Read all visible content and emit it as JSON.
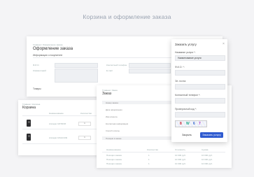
{
  "page_header": "Корзина и оформление заказа",
  "checkout": {
    "breadcrumb": "Главная / Оформление заказа",
    "title": "Оформление заказа",
    "section_buyer": "Информация о покупателе",
    "field_name": "Ф.И.О.",
    "field_comment": "Комментарий",
    "field_contact": "Контактный телефон",
    "field_email": "E-mail",
    "section_goods": "Товары"
  },
  "cart": {
    "breadcrumb": "Главная / Корзина",
    "title": "Корзина",
    "col_qty": "Количество",
    "col_name": "Наименование",
    "items": [
      {
        "name": "Аппарат МУЛЬТИ",
        "qty": "1"
      },
      {
        "name": "Аппарат КЛАССИК",
        "qty": "1"
      }
    ]
  },
  "order": {
    "breadcrumb": "Главная / Заказ",
    "title": "Заказ",
    "rows": [
      "Номер заказа",
      "Дата оформления",
      "Имя клиента",
      "Контактная информация",
      "Способ оплаты"
    ],
    "section": "Позиции в заказе",
    "table_headers": [
      "Наименование",
      "Количество",
      "Стоимость",
      "Сумма"
    ],
    "table_rows": [
      [
        "Позиция заказа",
        "1",
        "10 000 руб.",
        "10 000 руб."
      ],
      [
        "Позиция заказа",
        "1",
        "10 000 руб.",
        "10 000 руб."
      ],
      [
        "Позиция заказа",
        "1",
        "10 000 руб.",
        "10 000 руб."
      ]
    ]
  },
  "modal": {
    "title": "Заказать услугу",
    "label_service": "Название услуги *:",
    "service_value": "Наименование услуги",
    "label_name": "Ф.И.О. *:",
    "label_email": "Эл. почта:",
    "label_phone": "Контактный телефон *:",
    "label_captcha": "Проверочный код *:",
    "captcha_text": "8W67",
    "close_button": "Закрыть",
    "submit_button": "Заказать услугу",
    "accent_color": "#2f5bd0"
  }
}
